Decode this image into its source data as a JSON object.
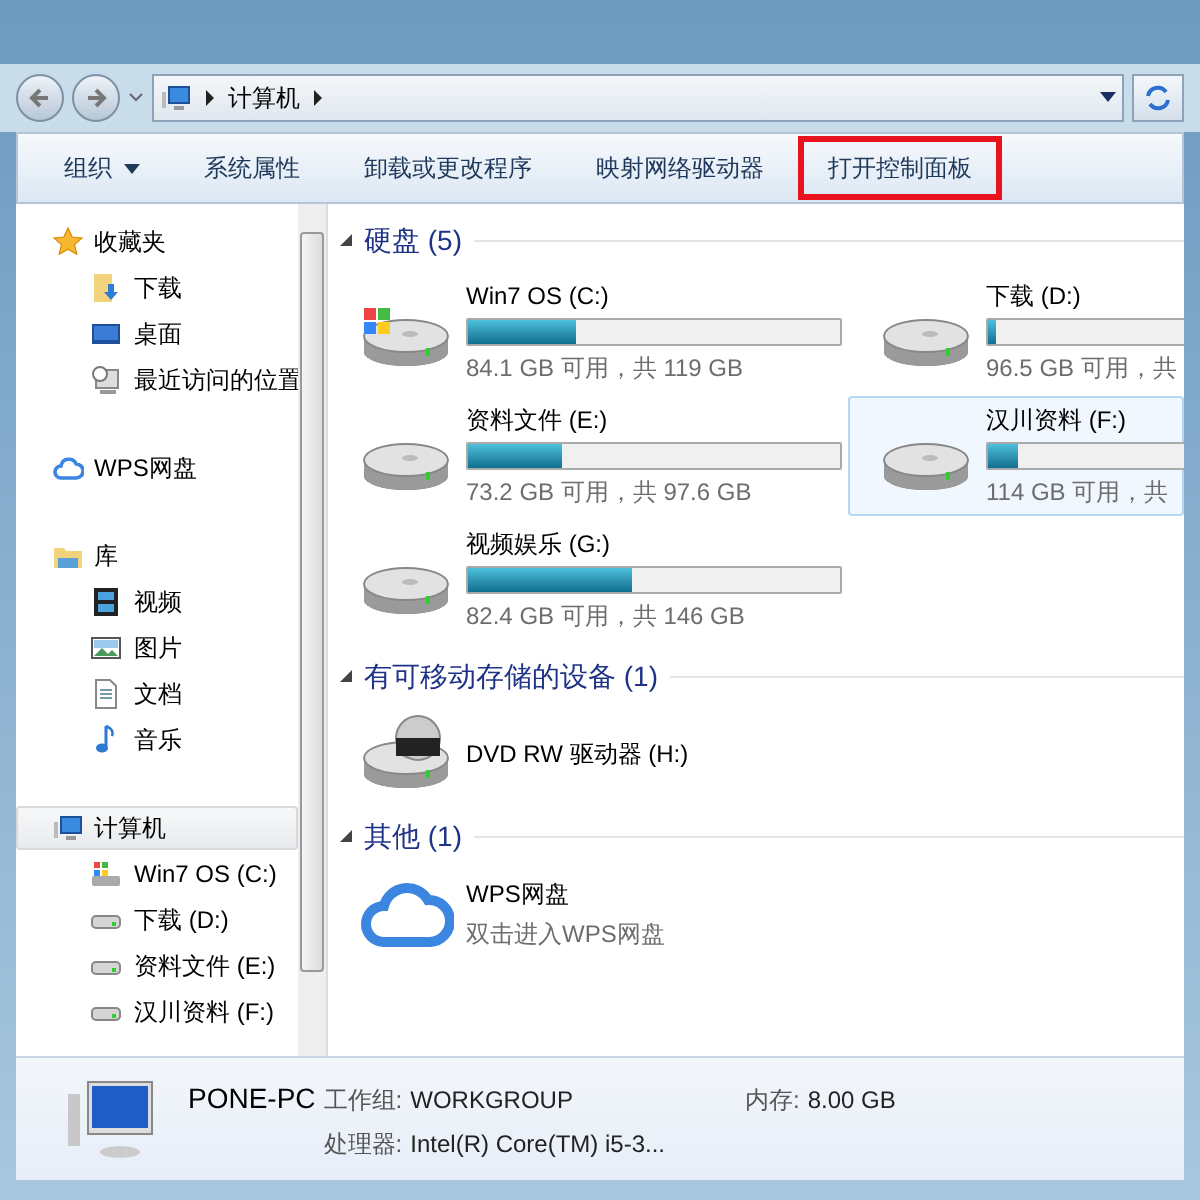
{
  "address": {
    "path": [
      "计算机"
    ]
  },
  "toolbar": [
    {
      "label": "组织",
      "dropdown": true,
      "highlighted": false
    },
    {
      "label": "系统属性",
      "dropdown": false,
      "highlighted": false
    },
    {
      "label": "卸载或更改程序",
      "dropdown": false,
      "highlighted": false
    },
    {
      "label": "映射网络驱动器",
      "dropdown": false,
      "highlighted": false
    },
    {
      "label": "打开控制面板",
      "dropdown": false,
      "highlighted": true
    }
  ],
  "sidebar": {
    "groups": [
      {
        "label": "收藏夹",
        "kind": "star",
        "selected": false,
        "children": [
          {
            "label": "下载",
            "kind": "download"
          },
          {
            "label": "桌面",
            "kind": "desktop"
          },
          {
            "label": "最近访问的位置",
            "kind": "recent"
          }
        ]
      },
      {
        "label": "WPS网盘",
        "kind": "cloud",
        "selected": false
      },
      {
        "label": "库",
        "kind": "library",
        "selected": false,
        "children": [
          {
            "label": "视频",
            "kind": "video"
          },
          {
            "label": "图片",
            "kind": "picture"
          },
          {
            "label": "文档",
            "kind": "document"
          },
          {
            "label": "音乐",
            "kind": "music"
          }
        ]
      },
      {
        "label": "计算机",
        "kind": "computer",
        "selected": true,
        "children": [
          {
            "label": "Win7 OS (C:)",
            "kind": "system"
          },
          {
            "label": "下载 (D:)",
            "kind": "drive"
          },
          {
            "label": "资料文件 (E:)",
            "kind": "drive"
          },
          {
            "label": "汉川资料 (F:)",
            "kind": "drive"
          }
        ]
      }
    ]
  },
  "sections": [
    {
      "title": "硬盘 (5)",
      "items": [
        {
          "kind": "system",
          "name": "Win7 OS (C:)",
          "level": 0.29,
          "info": "84.1 GB 可用，共 119 GB",
          "selected": false
        },
        {
          "kind": "drive",
          "name": "下载 (D:)",
          "level": 0.02,
          "info": "96.5 GB 可用，共",
          "selected": false
        },
        {
          "kind": "drive",
          "name": "资料文件 (E:)",
          "level": 0.25,
          "info": "73.2 GB 可用，共 97.6 GB",
          "selected": false
        },
        {
          "kind": "drive",
          "name": "汉川资料 (F:)",
          "level": 0.08,
          "info": "114 GB 可用，共",
          "selected": true
        },
        {
          "kind": "drive",
          "name": "视频娱乐 (G:)",
          "level": 0.44,
          "info": "82.4 GB 可用，共 146 GB",
          "selected": false
        }
      ]
    },
    {
      "title": "有可移动存储的设备 (1)",
      "items": [
        {
          "kind": "dvd",
          "name": "DVD RW 驱动器 (H:)",
          "selected": false
        }
      ]
    },
    {
      "title": "其他 (1)",
      "items": [
        {
          "kind": "cloud",
          "name": "WPS网盘",
          "info": "双击进入WPS网盘",
          "selected": false
        }
      ]
    }
  ],
  "details": {
    "name": "PONE-PC",
    "fields": [
      {
        "label": "工作组:",
        "value": "WORKGROUP"
      },
      {
        "label": "内存:",
        "value": "8.00 GB"
      },
      {
        "label": "处理器:",
        "value": "Intel(R) Core(TM) i5-3..."
      }
    ]
  }
}
